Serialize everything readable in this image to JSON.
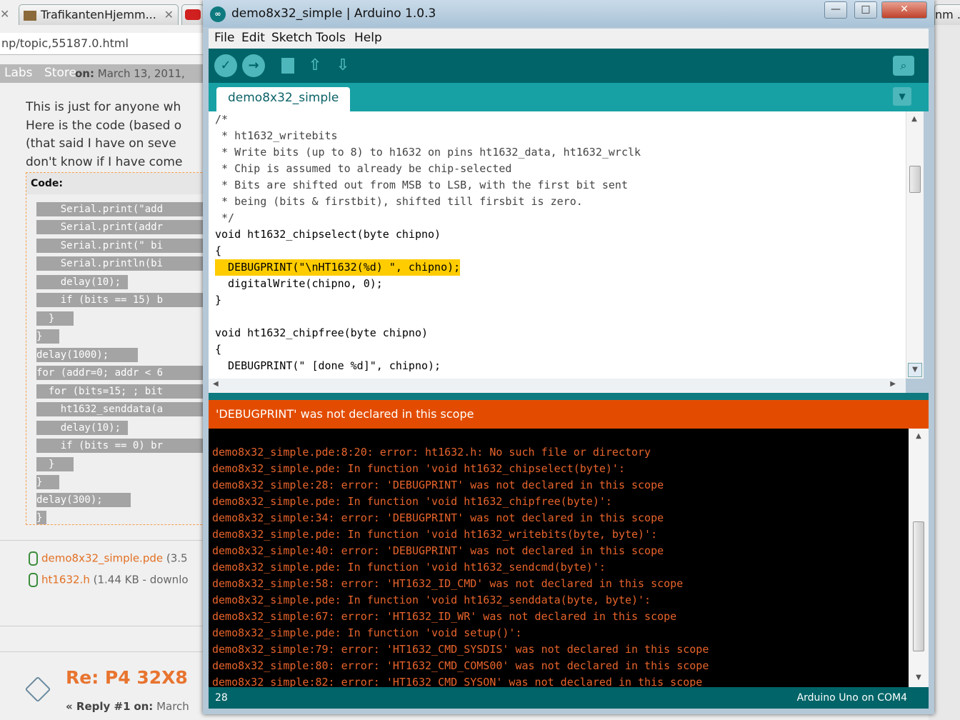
{
  "browser": {
    "tabs": [
      {
        "label": "TrafikantenHjemm..."
      },
      {
        "label": "nm ..."
      }
    ],
    "url": "np/topic,55187.0.html",
    "nav": [
      "Labs",
      "Store"
    ],
    "post_date_label": "on:",
    "post_date": "March 13, 2011,",
    "post_lines": [
      "This is just for anyone wh",
      "Here is the code (based o",
      "(that said I have on seve",
      "don't know if I have come"
    ],
    "code_header": "Code:",
    "code_lines": [
      "    Serial.print(\"add",
      "    Serial.print(addr",
      "    Serial.print(\" bi",
      "    Serial.println(bi",
      "    delay(10);",
      "    if (bits == 15) b",
      "  }",
      "}",
      "delay(1000);",
      "for (addr=0; addr < 6",
      "  for (bits=15; ; bit",
      "    ht1632_senddata(a",
      "    delay(10);",
      "    if (bits == 0) br",
      "  }",
      "}",
      "delay(300);",
      "}"
    ],
    "attachments": [
      {
        "name": "demo8x32_simple.pde",
        "meta": "(3.5"
      },
      {
        "name": "ht1632.h",
        "meta": "(1.44 KB - downlo"
      }
    ],
    "reply_title": "Re: P4 32X8",
    "reply_meta_prefix": "« Reply #1",
    "reply_meta_on": "on:",
    "reply_meta_date": "March"
  },
  "ide": {
    "window_title": "demo8x32_simple | Arduino 1.0.3",
    "logo_text": "∞",
    "window_buttons": {
      "minimize": "—",
      "maximize": "□",
      "close": "✕"
    },
    "menu": [
      "File",
      "Edit",
      "Sketch",
      "Tools",
      "Help"
    ],
    "toolbar_icons": [
      "verify-icon",
      "upload-icon",
      "new-icon",
      "open-icon",
      "save-icon",
      "serial-monitor-icon"
    ],
    "sketch_tab": "demo8x32_simple",
    "code": [
      "/*",
      " * ht1632_writebits",
      " * Write bits (up to 8) to h1632 on pins ht1632_data, ht1632_wrclk",
      " * Chip is assumed to already be chip-selected",
      " * Bits are shifted out from MSB to LSB, with the first bit sent",
      " * being (bits & firstbit), shifted till firsbit is zero.",
      " */",
      "void ht1632_chipselect(byte chipno)",
      "{",
      "  DEBUGPRINT(\"\\nHT1632(%d) \", chipno);",
      "  digitalWrite(chipno, 0);",
      "}",
      "",
      "void ht1632_chipfree(byte chipno)",
      "{",
      "  DEBUGPRINT(\" [done %d]\", chipno);"
    ],
    "status_message": "'DEBUGPRINT' was not declared in this scope",
    "console": [
      "demo8x32_simple.pde:8:20: error: ht1632.h: No such file or directory",
      "demo8x32_simple.pde: In function 'void ht1632_chipselect(byte)':",
      "demo8x32_simple:28: error: 'DEBUGPRINT' was not declared in this scope",
      "demo8x32_simple.pde: In function 'void ht1632_chipfree(byte)':",
      "demo8x32_simple:34: error: 'DEBUGPRINT' was not declared in this scope",
      "demo8x32_simple.pde: In function 'void ht1632_writebits(byte, byte)':",
      "demo8x32_simple:40: error: 'DEBUGPRINT' was not declared in this scope",
      "demo8x32_simple.pde: In function 'void ht1632_sendcmd(byte)':",
      "demo8x32_simple:58: error: 'HT1632_ID_CMD' was not declared in this scope",
      "demo8x32_simple.pde: In function 'void ht1632_senddata(byte, byte)':",
      "demo8x32_simple:67: error: 'HT1632_ID_WR' was not declared in this scope",
      "demo8x32_simple.pde: In function 'void setup()':",
      "demo8x32_simple:79: error: 'HT1632_CMD_SYSDIS' was not declared in this scope",
      "demo8x32_simple:80: error: 'HT1632_CMD_COMS00' was not declared in this scope",
      "demo8x32_simple:82: error: 'HT1632_CMD_SYSON' was not declared in this scope"
    ],
    "line_number": "28",
    "board": "Arduino Uno on COM4",
    "colors": {
      "teal": "#006468",
      "error_bar": "#e34c00",
      "highlight": "#ffcc00"
    }
  }
}
